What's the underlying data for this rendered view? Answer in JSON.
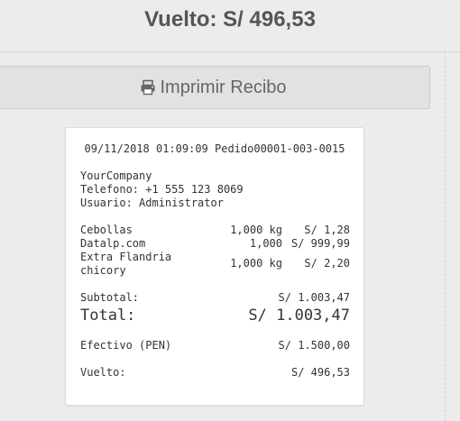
{
  "header": {
    "change_text": "Vuelto: S/ 496,53"
  },
  "print_button": {
    "label": "Imprimir Recibo",
    "icon": "printer-icon"
  },
  "receipt": {
    "header_line": "09/11/2018 01:09:09 Pedido00001-003-0015",
    "company": "YourCompany",
    "phone": "Telefono: +1 555 123 8069",
    "user": "Usuario: Administrator",
    "items": [
      {
        "name_line1": "Cebollas",
        "name_line2": "",
        "qty": "1,000 kg",
        "price": "S/ 1,28"
      },
      {
        "name_line1": "Datalp.com",
        "name_line2": "",
        "qty": "1,000",
        "price": "S/ 999,99"
      },
      {
        "name_line1": "Extra Flandria",
        "name_line2": "chicory",
        "qty": "1,000 kg",
        "price": "S/ 2,20"
      }
    ],
    "subtotal_label": "Subtotal:",
    "subtotal_value": "S/ 1.003,47",
    "total_label": "Total:",
    "total_value": "S/ 1.003,47",
    "payment_label": "Efectivo (PEN)",
    "payment_value": "S/ 1.500,00",
    "change_label": "Vuelto:",
    "change_value": "S/ 496,53"
  }
}
